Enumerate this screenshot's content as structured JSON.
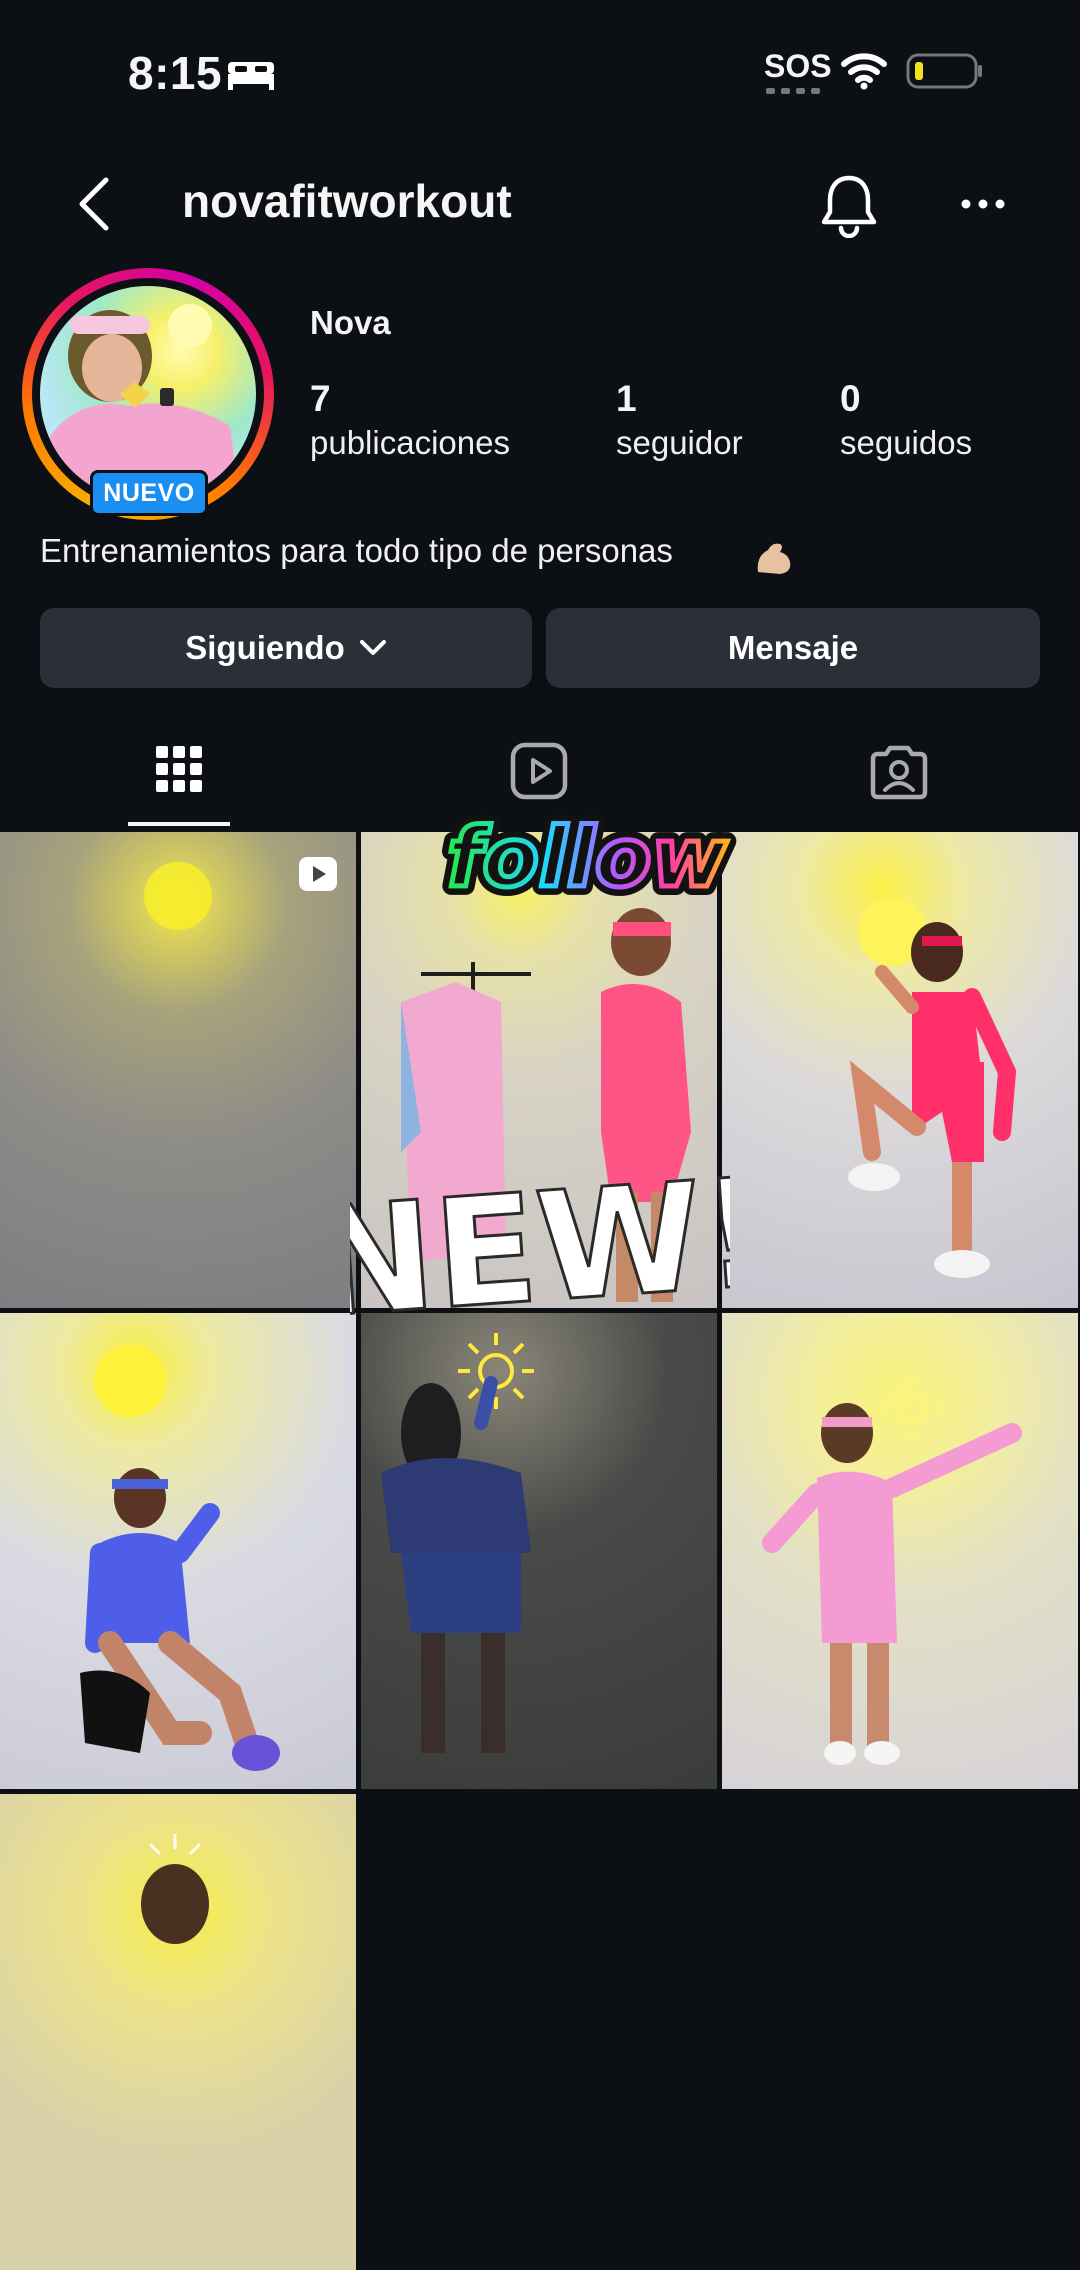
{
  "status_bar": {
    "time": "8:15",
    "sos": "SOS"
  },
  "header": {
    "username": "novafitworkout"
  },
  "profile": {
    "display_name": "Nova",
    "badge": "NUEVO",
    "stats": [
      {
        "count": "7",
        "label": "publicaciones"
      },
      {
        "count": "1",
        "label": "seguidor"
      },
      {
        "count": "0",
        "label": "seguidos"
      }
    ],
    "bio": "Entrenamientos para todo tipo de personas",
    "bio_emoji": "flexed-biceps"
  },
  "buttons": {
    "following": "Siguiendo",
    "message": "Mensaje"
  },
  "tabs": [
    "grid-tab",
    "reels-tab",
    "tagged-tab"
  ],
  "stickers": {
    "follow": "follow",
    "new": "NEW!"
  },
  "colors": {
    "background": "#0c0f14",
    "button": "#2a2f38",
    "badge": "#1b8ef2"
  }
}
